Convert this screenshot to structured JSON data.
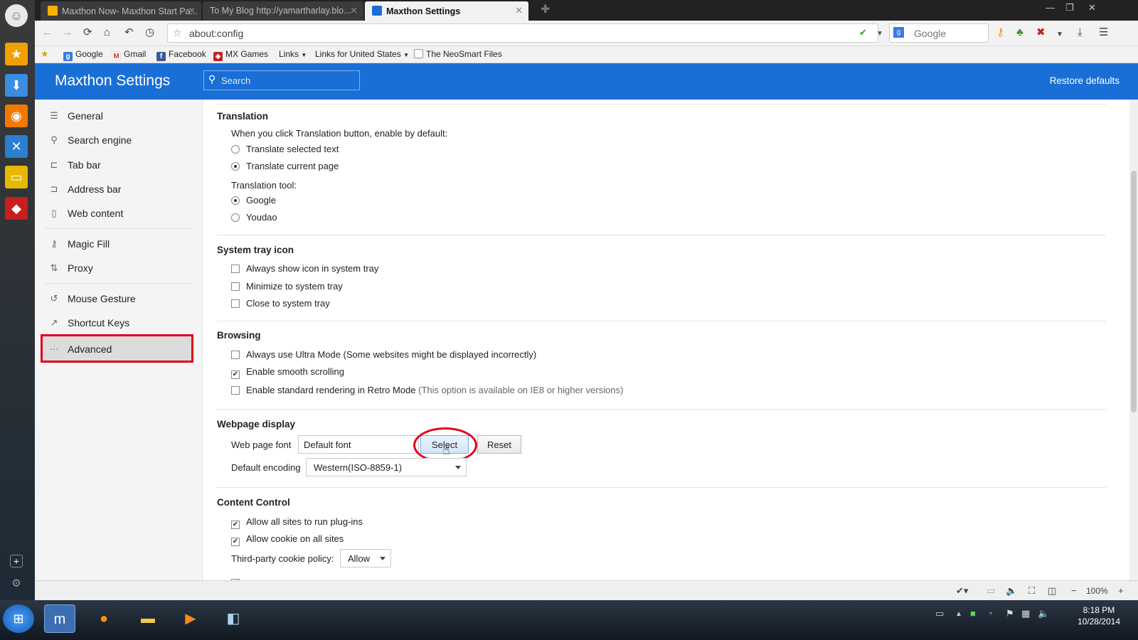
{
  "tabs": [
    {
      "label": "Maxthon Now- Maxthon Start Pa...",
      "active": false
    },
    {
      "label": "To My Blog http://yamartharlay.blo...",
      "active": false
    },
    {
      "label": "Maxthon Settings",
      "active": true
    }
  ],
  "toolbar": {
    "address": "about:config",
    "search_placeholder": "Google"
  },
  "bookmarks": [
    "Google",
    "Gmail",
    "Facebook",
    "MX Games",
    "Links",
    "Links for United States",
    "The NeoSmart Files"
  ],
  "header": {
    "title": "Maxthon Settings",
    "search_placeholder": "Search",
    "restore": "Restore defaults"
  },
  "sidebar": {
    "items": [
      {
        "label": "General",
        "icon": "sliders-icon"
      },
      {
        "label": "Search engine",
        "icon": "magnifier-icon"
      },
      {
        "label": "Tab bar",
        "icon": "tab-icon"
      },
      {
        "label": "Address bar",
        "icon": "address-icon"
      },
      {
        "label": "Web content",
        "icon": "page-icon"
      },
      {
        "label": "Magic Fill",
        "icon": "key-icon"
      },
      {
        "label": "Proxy",
        "icon": "proxy-icon"
      },
      {
        "label": "Mouse Gesture",
        "icon": "gesture-icon"
      },
      {
        "label": "Shortcut Keys",
        "icon": "shortcut-icon"
      },
      {
        "label": "Advanced",
        "icon": "dots-icon"
      }
    ],
    "active": "Advanced"
  },
  "translation": {
    "title": "Translation",
    "prompt": "When you click Translation button, enable by default:",
    "opt1": "Translate selected text",
    "opt2": "Translate current page",
    "tool_label": "Translation tool:",
    "tool1": "Google",
    "tool2": "Youdao"
  },
  "tray": {
    "title": "System tray icon",
    "opt1": "Always show icon in system tray",
    "opt2": "Minimize to system tray",
    "opt3": "Close to system tray"
  },
  "browsing": {
    "title": "Browsing",
    "opt1": "Always use Ultra Mode (Some websites might be displayed incorrectly)",
    "opt2": "Enable smooth scrolling",
    "opt3": "Enable standard rendering in Retro Mode",
    "opt3_note": "(This option is available on IE8 or higher versions)"
  },
  "webpage": {
    "title": "Webpage display",
    "font_label": "Web page font",
    "font_value": "Default font",
    "select_btn": "Select",
    "reset_btn": "Reset",
    "encoding_label": "Default encoding",
    "encoding_value": "Western(ISO-8859-1)"
  },
  "content_control": {
    "title": "Content Control",
    "opt1": "Allow all sites to run plug-ins",
    "opt2": "Allow cookie on all sites",
    "cookie_label": "Third-party cookie policy:",
    "cookie_value": "Allow"
  },
  "statusbar": {
    "zoom": "100%"
  },
  "clock": {
    "time": "8:18 PM",
    "date": "10/28/2014"
  },
  "colors": {
    "header": "#1a6fd6",
    "highlight": "#e0001b"
  }
}
